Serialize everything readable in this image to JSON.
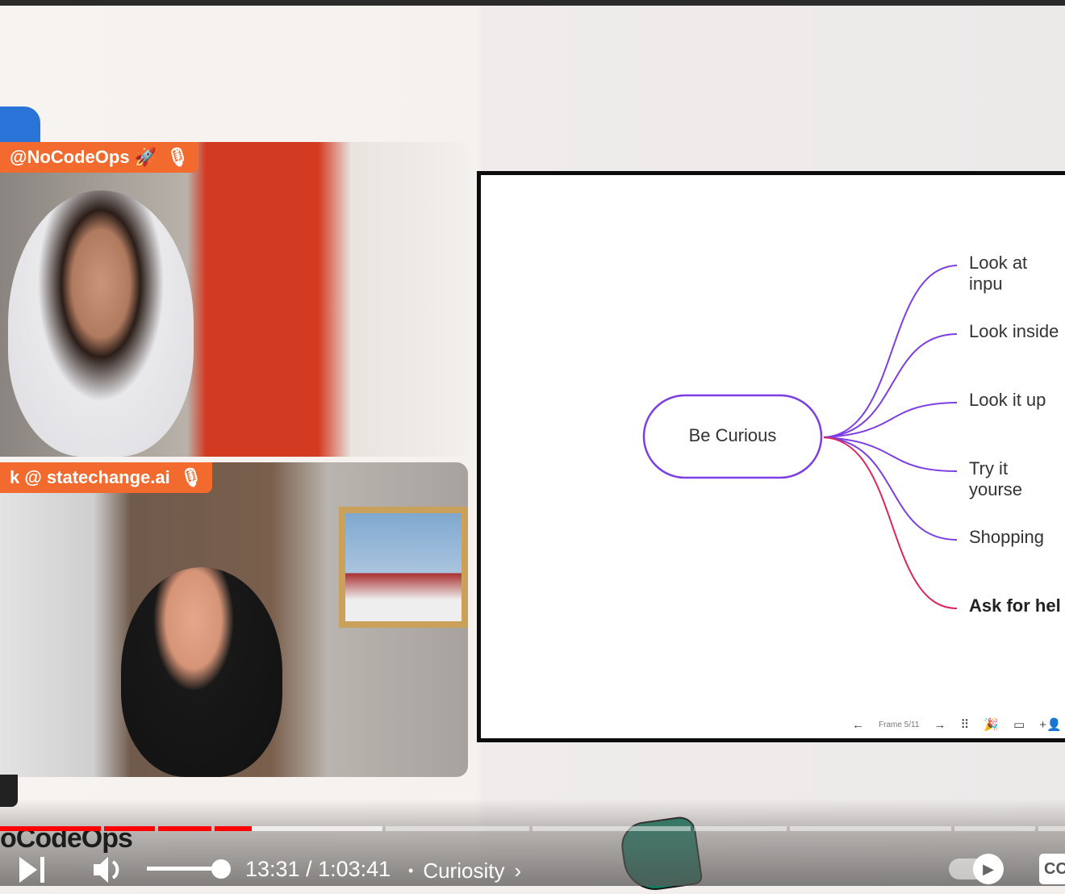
{
  "cams": [
    {
      "tag": "@NoCodeOps 🚀"
    },
    {
      "tag": "k @ statechange.ai"
    }
  ],
  "slide": {
    "center": "Be Curious",
    "branches": [
      "Look at inpu",
      "Look inside",
      "Look it up",
      "Try it yourse",
      "Shopping",
      "Ask for hel"
    ],
    "frame_label": "Frame 5/11",
    "toolbar_icons": [
      "arrow-left-icon",
      "arrow-right-icon",
      "shapes-icon",
      "celebrate-icon",
      "comment-icon",
      "add-user-icon"
    ],
    "line_color": "#7b3fe4",
    "highlight_color": "#e0245e"
  },
  "brand": "oCodeOps",
  "player": {
    "current_time": "13:31",
    "duration": "1:03:41",
    "time_text": "13:31 / 1:03:41",
    "chapter": "Curiosity",
    "progress_percent": 21.2,
    "volume_percent": 100,
    "accent": "#ff0000",
    "cc_label": "CC"
  }
}
